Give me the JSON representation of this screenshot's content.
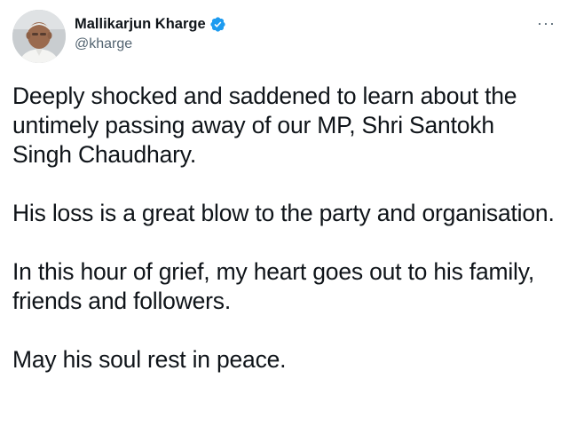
{
  "author": {
    "display_name": "Mallikarjun Kharge",
    "handle": "@kharge",
    "verified": true,
    "verified_color": "#1d9bf0"
  },
  "menu": {
    "more_icon": "more-horizontal-icon",
    "more_glyph": "···"
  },
  "tweet": {
    "paragraphs": [
      "Deeply shocked and saddened to learn about the untimely passing away of our MP, Shri Santokh Singh Chaudhary.",
      "His loss is a great blow to the party and organisation.",
      "In this hour of grief, my heart goes out to his family, friends and followers.",
      "May his soul rest in peace."
    ]
  }
}
